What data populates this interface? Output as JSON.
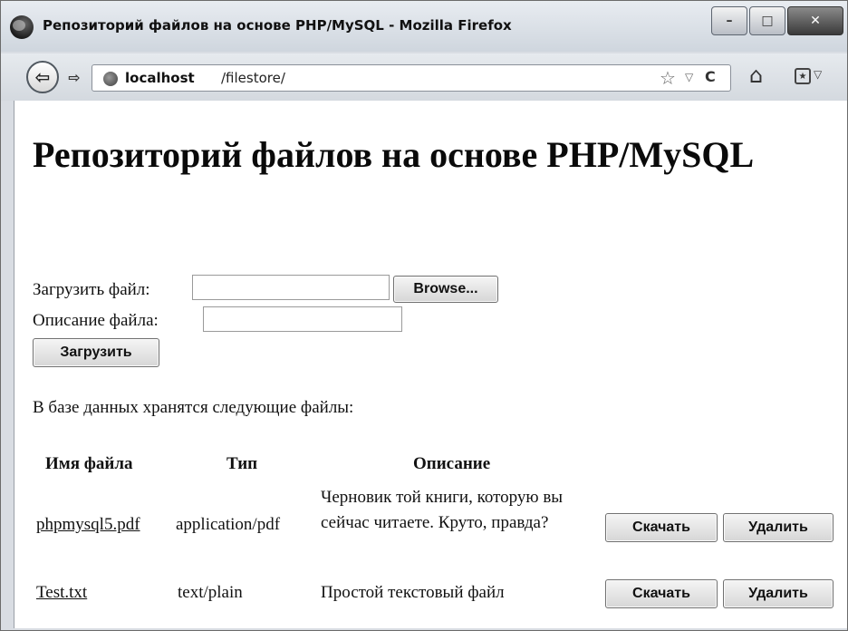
{
  "window": {
    "title": "Репозиторий файлов на основе PHP/MySQL - Mozilla Firefox",
    "minimize": "–",
    "maximize": "□",
    "close": "✕"
  },
  "nav": {
    "back": "⇦",
    "forward": "⇨",
    "url_host": "localhost",
    "url_path": "/filestore/",
    "star": "☆",
    "dropdown": "▽",
    "reload": "C",
    "home": "⌂",
    "bookmarks": "★",
    "bookmarks_dropdown": "▽"
  },
  "page": {
    "heading": "Репозиторий файлов на основе PHP/MySQL",
    "upload_label": "Загрузить файл:",
    "upload_value": "",
    "browse_label": "Browse...",
    "desc_label": "Описание файла:",
    "desc_value": "",
    "submit_label": "Загрузить",
    "list_intro": "В базе данных хранятся следующие файлы:"
  },
  "table": {
    "headers": [
      "Имя файла",
      "Тип",
      "Описание"
    ],
    "rows": [
      {
        "name": "phpmysql5.pdf",
        "type": "application/pdf",
        "description": "Черновик той книги, которую вы сейчас читаете. Круто, правда?",
        "download": "Скачать",
        "delete": "Удалить"
      },
      {
        "name": "Test.txt",
        "type": "text/plain",
        "description": "Простой текстовый файл",
        "download": "Скачать",
        "delete": "Удалить"
      }
    ]
  },
  "icons": [
    "firefox-logo",
    "back-icon",
    "forward-icon",
    "site-identity-icon",
    "star-icon",
    "reload-icon",
    "home-icon",
    "bookmarks-icon"
  ]
}
